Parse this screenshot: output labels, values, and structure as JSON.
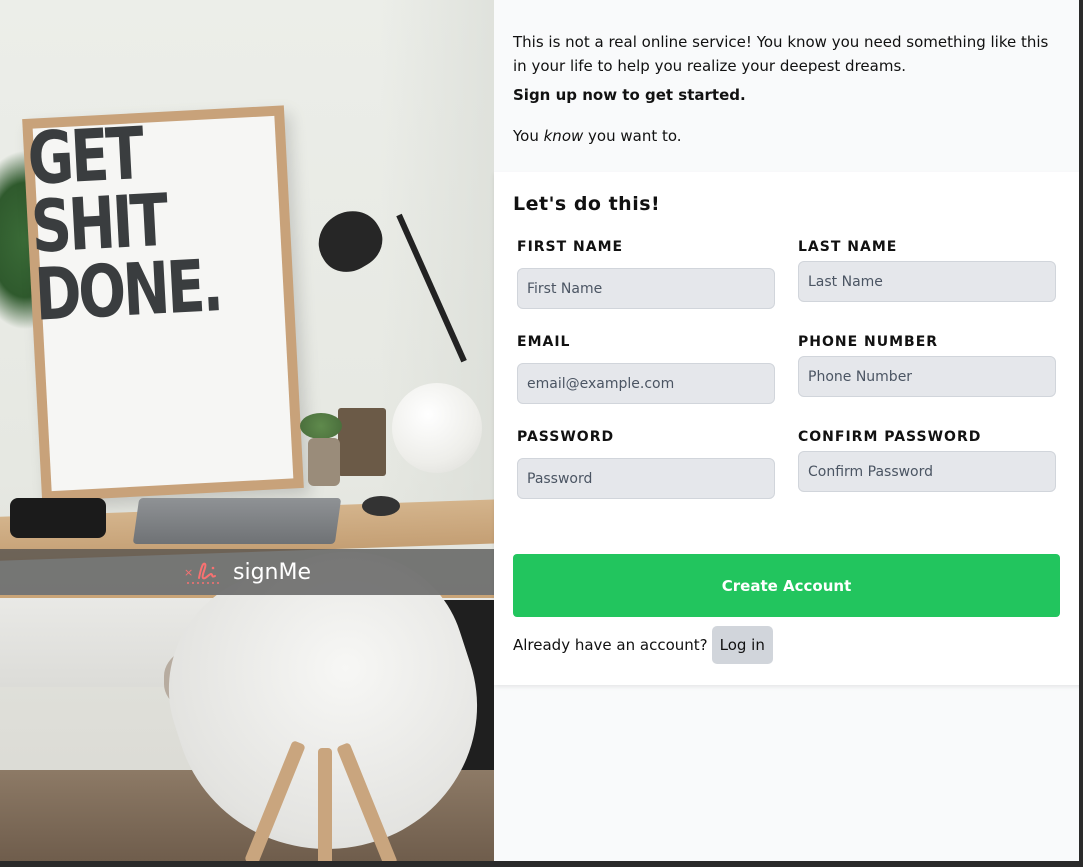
{
  "hero": {
    "brand_name": "signMe",
    "poster_lines": [
      "GET",
      "SHIT",
      "DONE."
    ]
  },
  "intro": {
    "line1": "This is not a real online service! You know you need something like this in your life to help you realize your deepest dreams.",
    "line2": "Sign up now to get started.",
    "line3_before": "You ",
    "line3_em": "know",
    "line3_after": " you want to."
  },
  "form": {
    "title": "Let's do this!",
    "fields": {
      "first_name": {
        "label": "FIRST NAME",
        "placeholder": "First Name"
      },
      "last_name": {
        "label": "LAST NAME",
        "placeholder": "Last Name"
      },
      "email": {
        "label": "EMAIL",
        "placeholder": "email@example.com"
      },
      "phone": {
        "label": "PHONE NUMBER",
        "placeholder": "Phone Number"
      },
      "password": {
        "label": "PASSWORD",
        "placeholder": "Password"
      },
      "confirm_password": {
        "label": "CONFIRM PASSWORD",
        "placeholder": "Confirm Password"
      }
    },
    "submit_label": "Create Account",
    "login_prompt": "Already have an account?",
    "login_label": "Log in"
  },
  "colors": {
    "accent": "#22c55e",
    "input_bg": "#e5e7eb",
    "page_bg": "#f9fafb",
    "brand_logo": "#f87171"
  }
}
